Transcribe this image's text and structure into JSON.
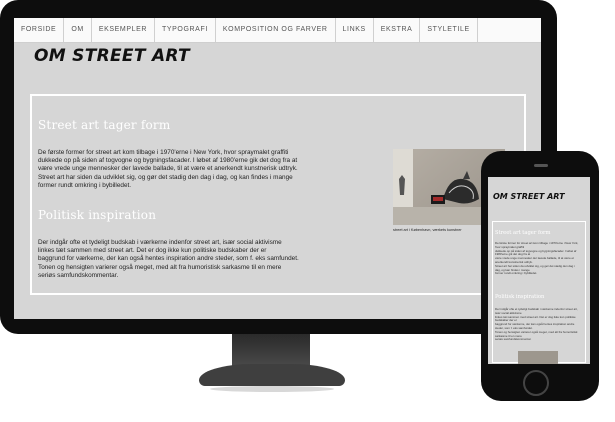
{
  "nav": {
    "items": [
      "FORSIDE",
      "OM",
      "EKSEMPLER",
      "TYPOGRAFI",
      "KOMPOSITION OG FARVER",
      "LINKS",
      "EKSTRA",
      "STYLETILE"
    ]
  },
  "page": {
    "title": "OM STREET ART"
  },
  "section1": {
    "heading": "Street art tager form",
    "lines": [
      "De første former for street art kom tilbage i 1970'erne i New York, hvor spraymalet graffiti",
      "dukkede op på siden af togvogne og bygningsfacader. I løbet af 1980'erne gik det dog fra at",
      "være vrede unge mennesker der lavede ballade, til at være et anerkendt kunstnerisk udtryk.",
      "Street art har siden da udviklet sig, og gør det stadig den dag i dag, og kan findes i mange",
      "former rundt omkring i bybilledet."
    ]
  },
  "section2": {
    "heading": "Politisk inspiration",
    "lines": [
      "Der indgår ofte et tydeligt budskab i værkerne indenfor street art, især social aktivisme",
      "linkes tæt sammen med street art. Det er dog ikke kun politiske budskaber der er",
      "baggrund for værkerne, der kan også hentes inspiration andre steder, som f. eks samfundet.",
      "Tonen og hensigten varierer også meget, med alt fra humoristisk sarkasme til en mere",
      "seriøs samfundskommentar."
    ]
  },
  "photo": {
    "caption": "street art i København, værkets kunstner"
  },
  "colors": {
    "page_bg": "#d6d6d6",
    "bezel": "#0d0d0d",
    "heading": "#ffffff"
  }
}
